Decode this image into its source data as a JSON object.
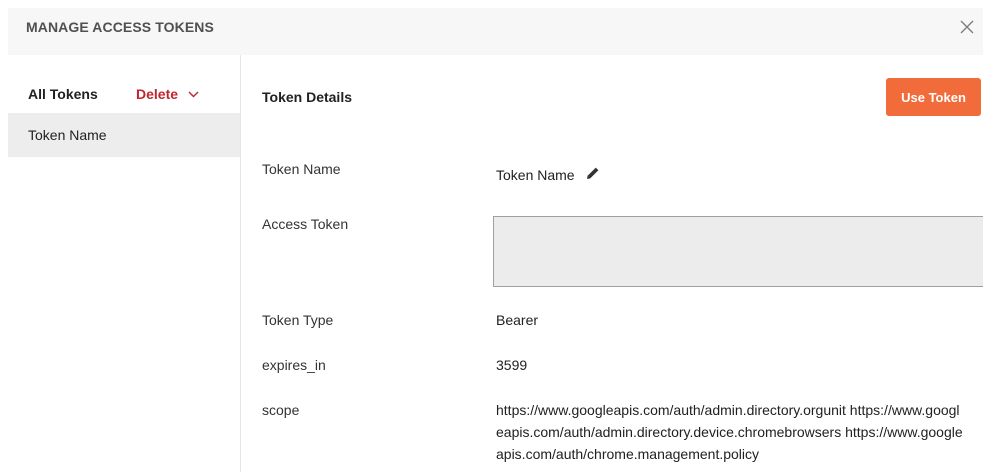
{
  "modal": {
    "title": "MANAGE ACCESS TOKENS",
    "close_icon": "close-icon"
  },
  "sidebar": {
    "header_label": "All Tokens",
    "delete_label": "Delete",
    "delete_icon": "chevron-down-icon",
    "tokens": [
      {
        "label": "Token Name",
        "selected": true
      }
    ]
  },
  "details": {
    "title": "Token Details",
    "use_token_label": "Use Token",
    "token_name_label": "Token Name",
    "token_name_value": "Token Name",
    "edit_icon": "pencil-icon",
    "access_token_label": "Access Token",
    "access_token_value": "",
    "token_type_label": "Token Type",
    "token_type_value": "Bearer",
    "expires_in_label": "expires_in",
    "expires_in_value": "3599",
    "scope_label": "scope",
    "scope_value": "https://www.googleapis.com/auth/admin.directory.orgunit https://www.googleapis.com/auth/admin.directory.device.chromebrowsers https://www.googleapis.com/auth/chrome.management.policy"
  },
  "colors": {
    "accent": "#f26b3a",
    "delete": "#c0262d",
    "header_bg": "#f7f7f7",
    "selected_bg": "#ededed"
  }
}
